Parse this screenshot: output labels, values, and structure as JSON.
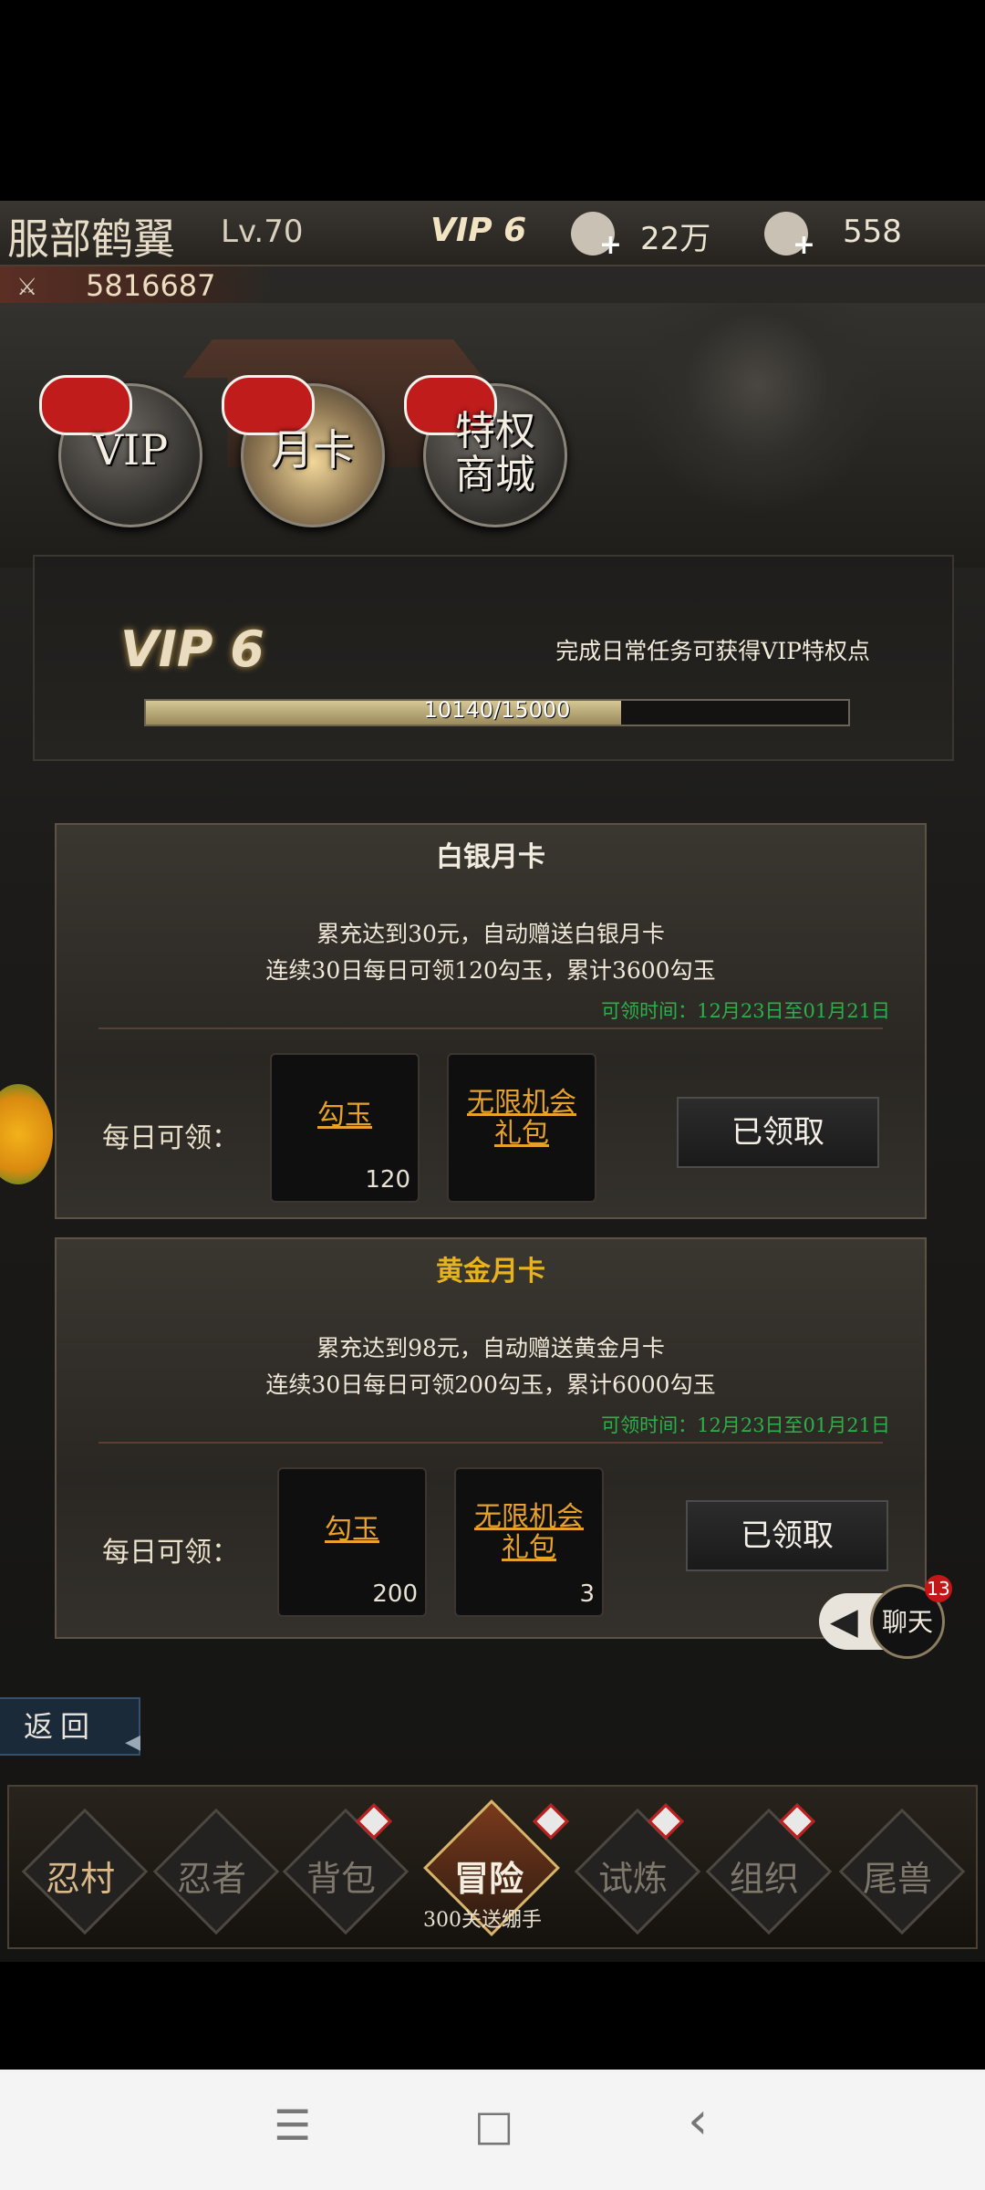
{
  "player": {
    "name": "服部鹤翼",
    "level": "Lv.70",
    "vip": "VIP 6",
    "coins": "22万",
    "gems": "558",
    "power": "5816687"
  },
  "tabs": [
    {
      "label": "VIP"
    },
    {
      "label": "月卡"
    },
    {
      "label": "特权\n商城"
    }
  ],
  "vip_panel": {
    "level": "VIP 6",
    "hint": "完成日常任务可获得VIP特权点",
    "progress_text": "10140/15000",
    "progress_fraction": 0.676
  },
  "cards": [
    {
      "title": "白银月卡",
      "title_color": "#f2ece0",
      "desc1": "累充达到30元，自动赠送白银月卡",
      "desc2": "连续30日每日可领120勾玉，累计3600勾玉",
      "period": "可领时间：12月23日至01月21日",
      "daily_label": "每日可领：",
      "items": [
        {
          "name": "勾玉",
          "count": "120"
        },
        {
          "name": "无限机会\n礼包",
          "count": ""
        }
      ],
      "button": "已领取"
    },
    {
      "title": "黄金月卡",
      "title_color": "#e6b31e",
      "desc1": "累充达到98元，自动赠送黄金月卡",
      "desc2": "连续30日每日可领200勾玉，累计6000勾玉",
      "period": "可领时间：12月23日至01月21日",
      "daily_label": "每日可领：",
      "items": [
        {
          "name": "勾玉",
          "count": "200"
        },
        {
          "name": "无限机会\n礼包",
          "count": "3"
        }
      ],
      "button": "已领取"
    }
  ],
  "chat": {
    "label": "聊天",
    "badge": "13",
    "arrow": "◀"
  },
  "back": {
    "label": "返回",
    "arrow": "◀"
  },
  "nav": {
    "items": [
      "忍村",
      "忍者",
      "背包",
      "冒险",
      "试炼",
      "组织",
      "尾兽"
    ],
    "active": "冒险",
    "subtitle": "300关送绷手"
  },
  "system_nav": {
    "menu": "☰",
    "home": "□",
    "back": "‹"
  }
}
